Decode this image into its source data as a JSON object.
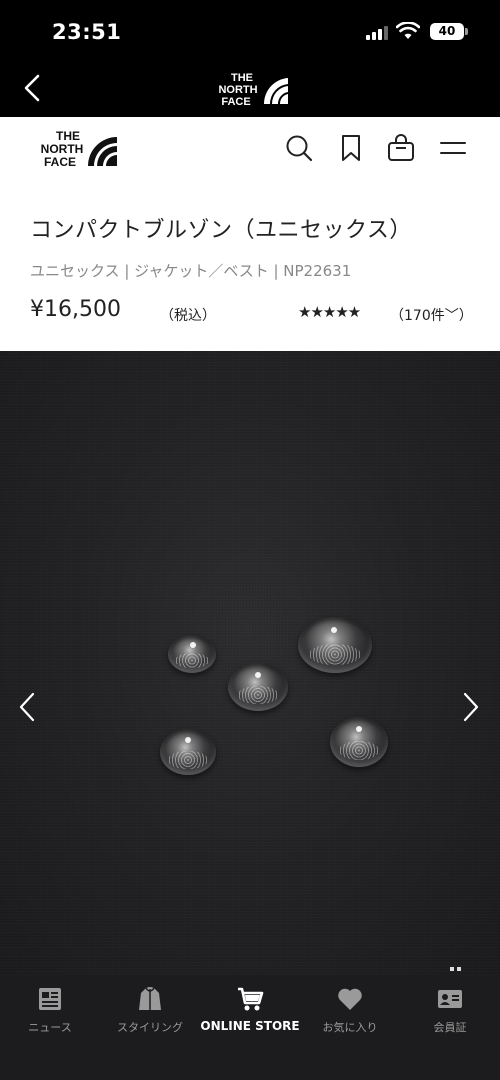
{
  "status_bar": {
    "time": "23:51",
    "battery": "40"
  },
  "app_header": {
    "logo_text": [
      "THE",
      "NORTH",
      "FACE"
    ]
  },
  "nav": {
    "icons": [
      "search-icon",
      "bookmark-icon",
      "cart-icon",
      "menu-icon"
    ]
  },
  "product": {
    "title": "コンパクトブルゾン（ユニセックス）",
    "meta": "ユニセックス | ジャケット／ベスト | NP22631",
    "price": "¥16,500",
    "tax_note": "（税込）",
    "stars": "★★★★★",
    "rating": 5,
    "reviews": "（170件﹀）"
  },
  "carousel": {
    "image_description_icon": "water-droplets-on-fabric",
    "prev_icon": "chevron-left-icon",
    "next_icon": "chevron-right-icon"
  },
  "tabbar": {
    "tabs": [
      {
        "label": "ニュース",
        "icon": "news-icon",
        "active": false
      },
      {
        "label": "スタイリング",
        "icon": "styling-icon",
        "active": false
      },
      {
        "label": "ONLINE STORE",
        "icon": "store-cart-icon",
        "active": true
      },
      {
        "label": "お気に入り",
        "icon": "heart-icon",
        "active": false
      },
      {
        "label": "会員証",
        "icon": "member-card-icon",
        "active": false
      }
    ]
  },
  "colors": {
    "header_bg": "#000000",
    "tabbar_bg": "#1c1c1e",
    "text": "#222222",
    "meta_text": "#888888"
  }
}
